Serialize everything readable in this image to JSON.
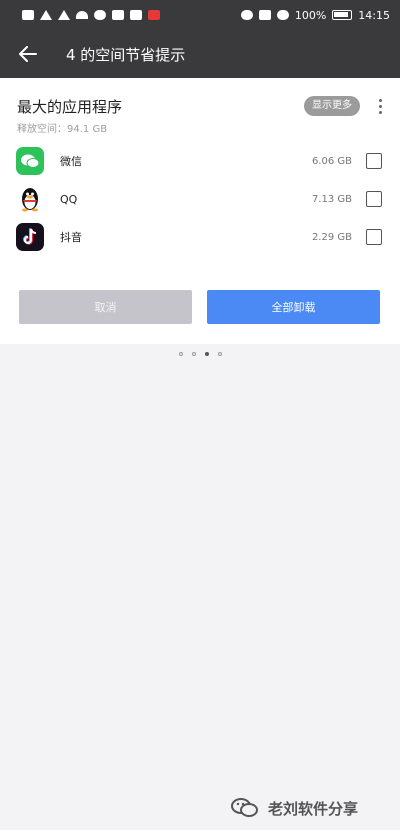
{
  "status_bar": {
    "battery_percent": "100%",
    "time": "14:15"
  },
  "app_bar": {
    "title": "4 的空间节省提示"
  },
  "section": {
    "title": "最大的应用程序",
    "subtitle": "释放空间：94.1 GB",
    "pill_label": "显示更多"
  },
  "apps": [
    {
      "name": "微信",
      "size": "6.06 GB",
      "icon": "wechat-icon",
      "color": "#2ec35a"
    },
    {
      "name": "QQ",
      "size": "7.13 GB",
      "icon": "qq-penguin-icon",
      "color": "#111111"
    },
    {
      "name": "抖音",
      "size": "2.29 GB",
      "icon": "douyin-icon",
      "color": "#16101c"
    }
  ],
  "buttons": {
    "cancel": "取消",
    "confirm": "全部卸载"
  },
  "pagination": {
    "active_index": 2,
    "count": 4
  },
  "watermark": {
    "text": "老刘软件分享"
  },
  "colors": {
    "header": "#3a3a3c",
    "accent": "#4b8af5",
    "disabled": "#c4c4ca"
  }
}
